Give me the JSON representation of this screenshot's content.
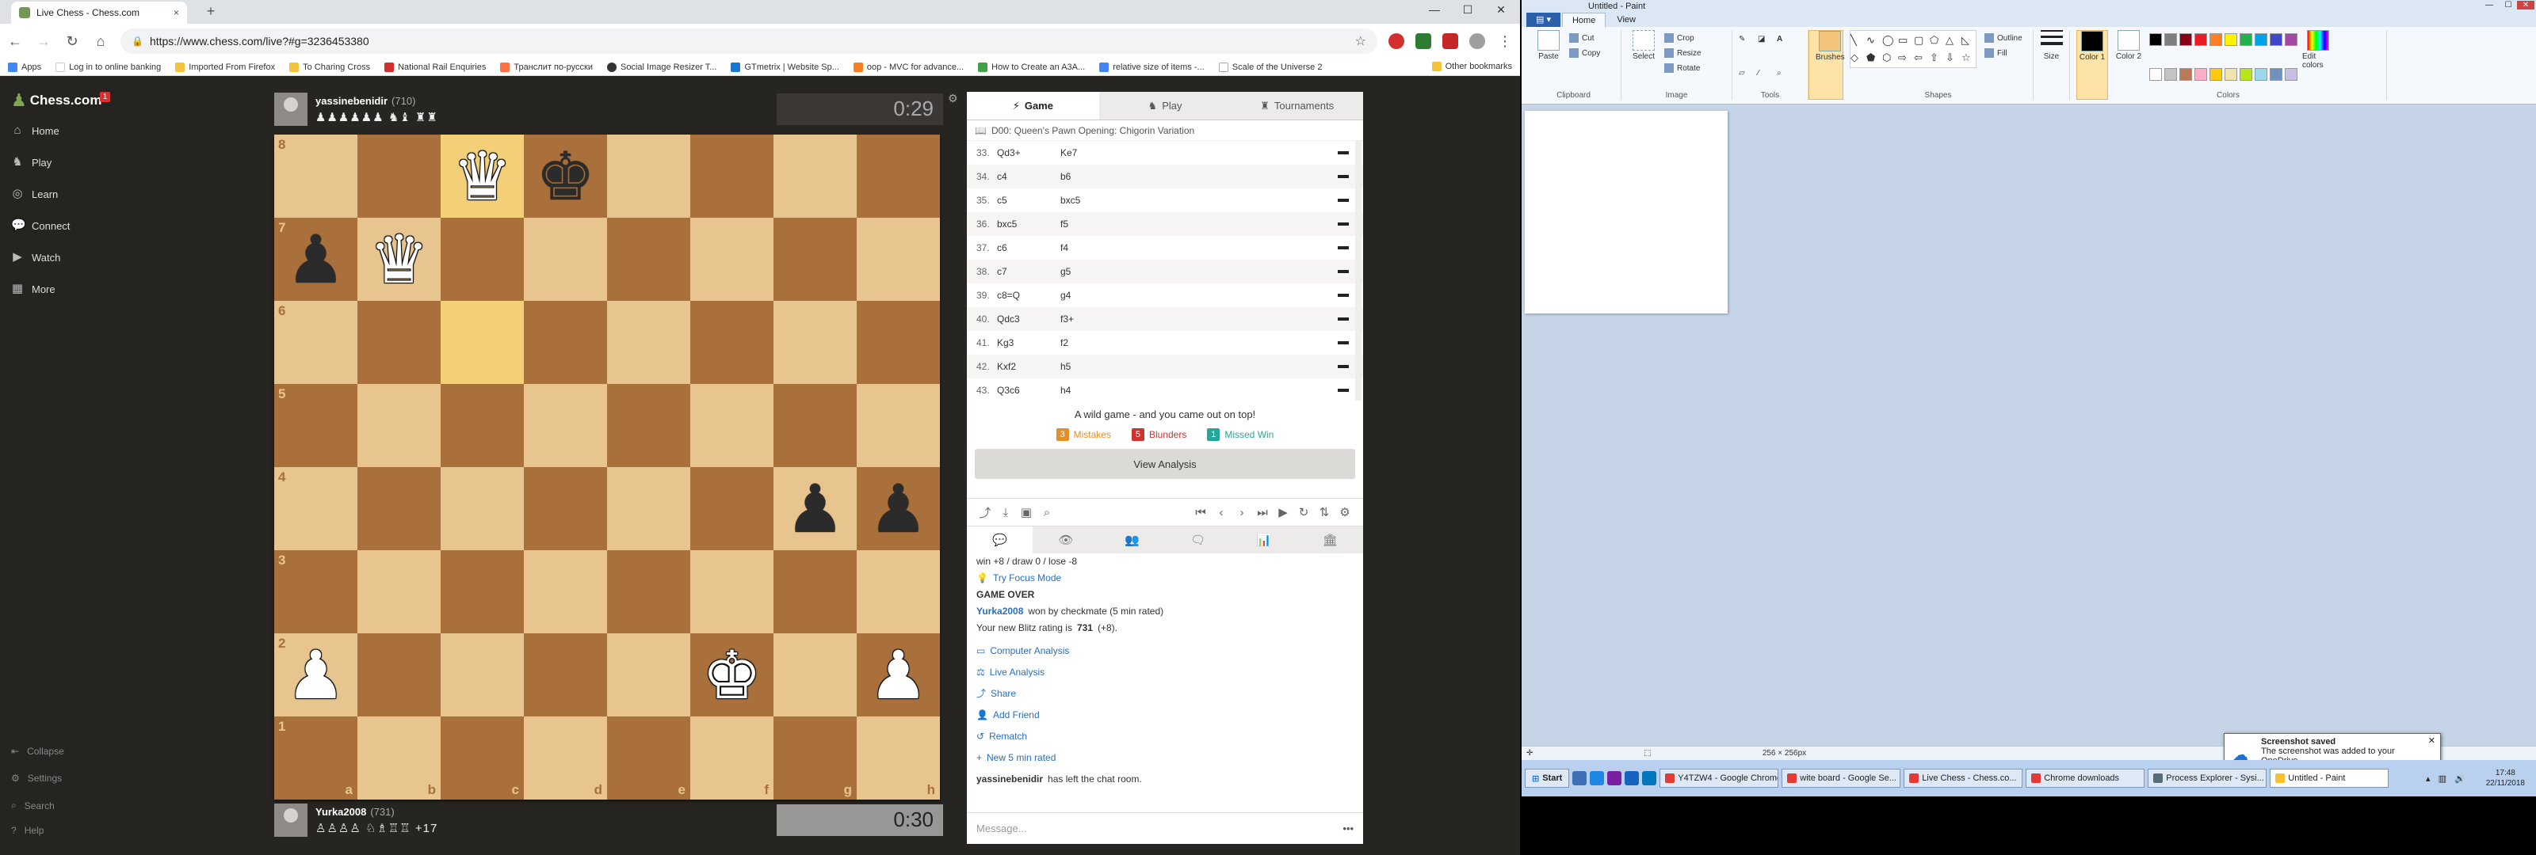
{
  "browser": {
    "tab_title": "Live Chess - Chess.com",
    "tab_close": "×",
    "new_tab": "+",
    "url": "https://www.chess.com/live?#g=3236453380",
    "bookmarks": [
      "Apps",
      "Log in to online banking",
      "Imported From Firefox",
      "To Charing Cross",
      "National Rail Enquiries",
      "Транслит по-русски",
      "Social Image Resizer T...",
      "GTmetrix | Website Sp...",
      "oop - MVC for advance...",
      "How to Create an A3A...",
      "relative size of items -...",
      "Scale of the Universe 2"
    ],
    "other_bookmarks": "Other bookmarks"
  },
  "nav": {
    "logo": "Chess.com",
    "badge": "1",
    "items": [
      "Home",
      "Play",
      "Learn",
      "Connect",
      "Watch",
      "More"
    ],
    "footer": [
      "Collapse",
      "Settings",
      "Search",
      "Help"
    ]
  },
  "game": {
    "top_player": {
      "name": "yassinebenidir",
      "rating": "(710)",
      "captured": "♟♟♟♟♟♟ ♞♝ ♜♜",
      "clock": "0:29"
    },
    "bottom_player": {
      "name": "Yurka2008",
      "rating": "(731)",
      "captured": "♙♙♙♙ ♘♗♖♖ +17",
      "clock": "0:30"
    },
    "board": [
      [
        "",
        "",
        "wQ",
        "bK",
        "",
        "",
        "",
        ""
      ],
      [
        "bP",
        "wQ",
        "",
        "",
        "",
        "",
        "",
        ""
      ],
      [
        "",
        "",
        "",
        "",
        "",
        "",
        "",
        ""
      ],
      [
        "",
        "",
        "",
        "",
        "",
        "",
        "",
        ""
      ],
      [
        "",
        "",
        "",
        "",
        "",
        "",
        "bP",
        "bP"
      ],
      [
        "",
        "",
        "",
        "",
        "",
        "",
        "",
        ""
      ],
      [
        "wP",
        "",
        "",
        "",
        "",
        "wK",
        "",
        "wP"
      ],
      [
        "",
        "",
        "",
        "",
        "",
        "",
        "",
        ""
      ]
    ],
    "highlight": [
      "c8",
      "c6"
    ],
    "ranks": [
      "8",
      "7",
      "6",
      "5",
      "4",
      "3",
      "2",
      "1"
    ],
    "files": [
      "a",
      "b",
      "c",
      "d",
      "e",
      "f",
      "g",
      "h"
    ]
  },
  "panel": {
    "tabs": [
      "Game",
      "Play",
      "Tournaments"
    ],
    "opening": "D00: Queen's Pawn Opening: Chigorin Variation",
    "moves": [
      {
        "n": "33.",
        "w": "Qd3+",
        "b": "Ke7"
      },
      {
        "n": "34.",
        "w": "c4",
        "b": "b6"
      },
      {
        "n": "35.",
        "w": "c5",
        "b": "bxc5"
      },
      {
        "n": "36.",
        "w": "bxc5",
        "b": "f5"
      },
      {
        "n": "37.",
        "w": "c6",
        "b": "f4"
      },
      {
        "n": "38.",
        "w": "c7",
        "b": "g5"
      },
      {
        "n": "39.",
        "w": "c8=Q",
        "b": "g4"
      },
      {
        "n": "40.",
        "w": "Qdc3",
        "b": "f3+"
      },
      {
        "n": "41.",
        "w": "Kg3",
        "b": "f2"
      },
      {
        "n": "42.",
        "w": "Kxf2",
        "b": "h5"
      },
      {
        "n": "43.",
        "w": "Q3c6",
        "b": "h4"
      }
    ],
    "result": "A wild game - and you came out on top!",
    "stats": [
      {
        "n": "3",
        "label": "Mistakes",
        "color": "#e58f2a"
      },
      {
        "n": "5",
        "label": "Blunders",
        "color": "#ca3431"
      },
      {
        "n": "1",
        "label": "Missed Win",
        "color": "#26a69a"
      }
    ],
    "view_analysis": "View Analysis",
    "chat": {
      "line1": "win +8 / draw 0 / lose -8",
      "focus": "Try Focus Mode",
      "game_over": "GAME OVER",
      "winner": "Yurka2008",
      "winner_text": "won by checkmate (5 min rated)",
      "rating_text": "Your new Blitz rating is",
      "rating_val": "731",
      "rating_delta": "(+8).",
      "links": [
        "Computer Analysis",
        "Live Analysis",
        "Share",
        "Add Friend",
        "Rematch",
        "New 5 min rated"
      ],
      "left_user": "yassinebenidir",
      "left_text": "has left the chat room.",
      "placeholder": "Message..."
    }
  },
  "paint": {
    "title": "Untitled - Paint",
    "file": "",
    "tabs": [
      "Home",
      "View"
    ],
    "groups": [
      "Clipboard",
      "Image",
      "Tools",
      "Shapes",
      "Colors"
    ],
    "clipboard": {
      "paste": "Paste",
      "cut": "Cut",
      "copy": "Copy"
    },
    "image": {
      "select": "Select",
      "crop": "Crop",
      "resize": "Resize",
      "rotate": "Rotate"
    },
    "brushes": "Brushes",
    "outline": "Outline",
    "fill": "Fill",
    "size": "Size",
    "color1": "Color 1",
    "color2": "Color 2",
    "edit_colors": "Edit colors",
    "palette": [
      "#000000",
      "#7f7f7f",
      "#880015",
      "#ed1c24",
      "#ff7f27",
      "#fff200",
      "#22b14c",
      "#00a2e8",
      "#3f48cc",
      "#a349a4",
      "#ffffff",
      "#c3c3c3",
      "#b97a57",
      "#ffaec9",
      "#ffc90e",
      "#efe4b0",
      "#b5e61d",
      "#99d9ea",
      "#7092be",
      "#c8bfe7"
    ],
    "status_size": "256 × 256px"
  },
  "toast": {
    "title": "Screenshot saved",
    "text": "The screenshot was added to your OneDrive."
  },
  "taskbar": {
    "start": "Start",
    "buttons": [
      "Y4TZW4 - Google Chrome",
      "wite board - Google Se...",
      "Live Chess - Chess.co...",
      "Chrome downloads",
      "Process Explorer - Sysi...",
      "Untitled - Paint"
    ],
    "time": "17:48",
    "date": "22/11/2018"
  }
}
